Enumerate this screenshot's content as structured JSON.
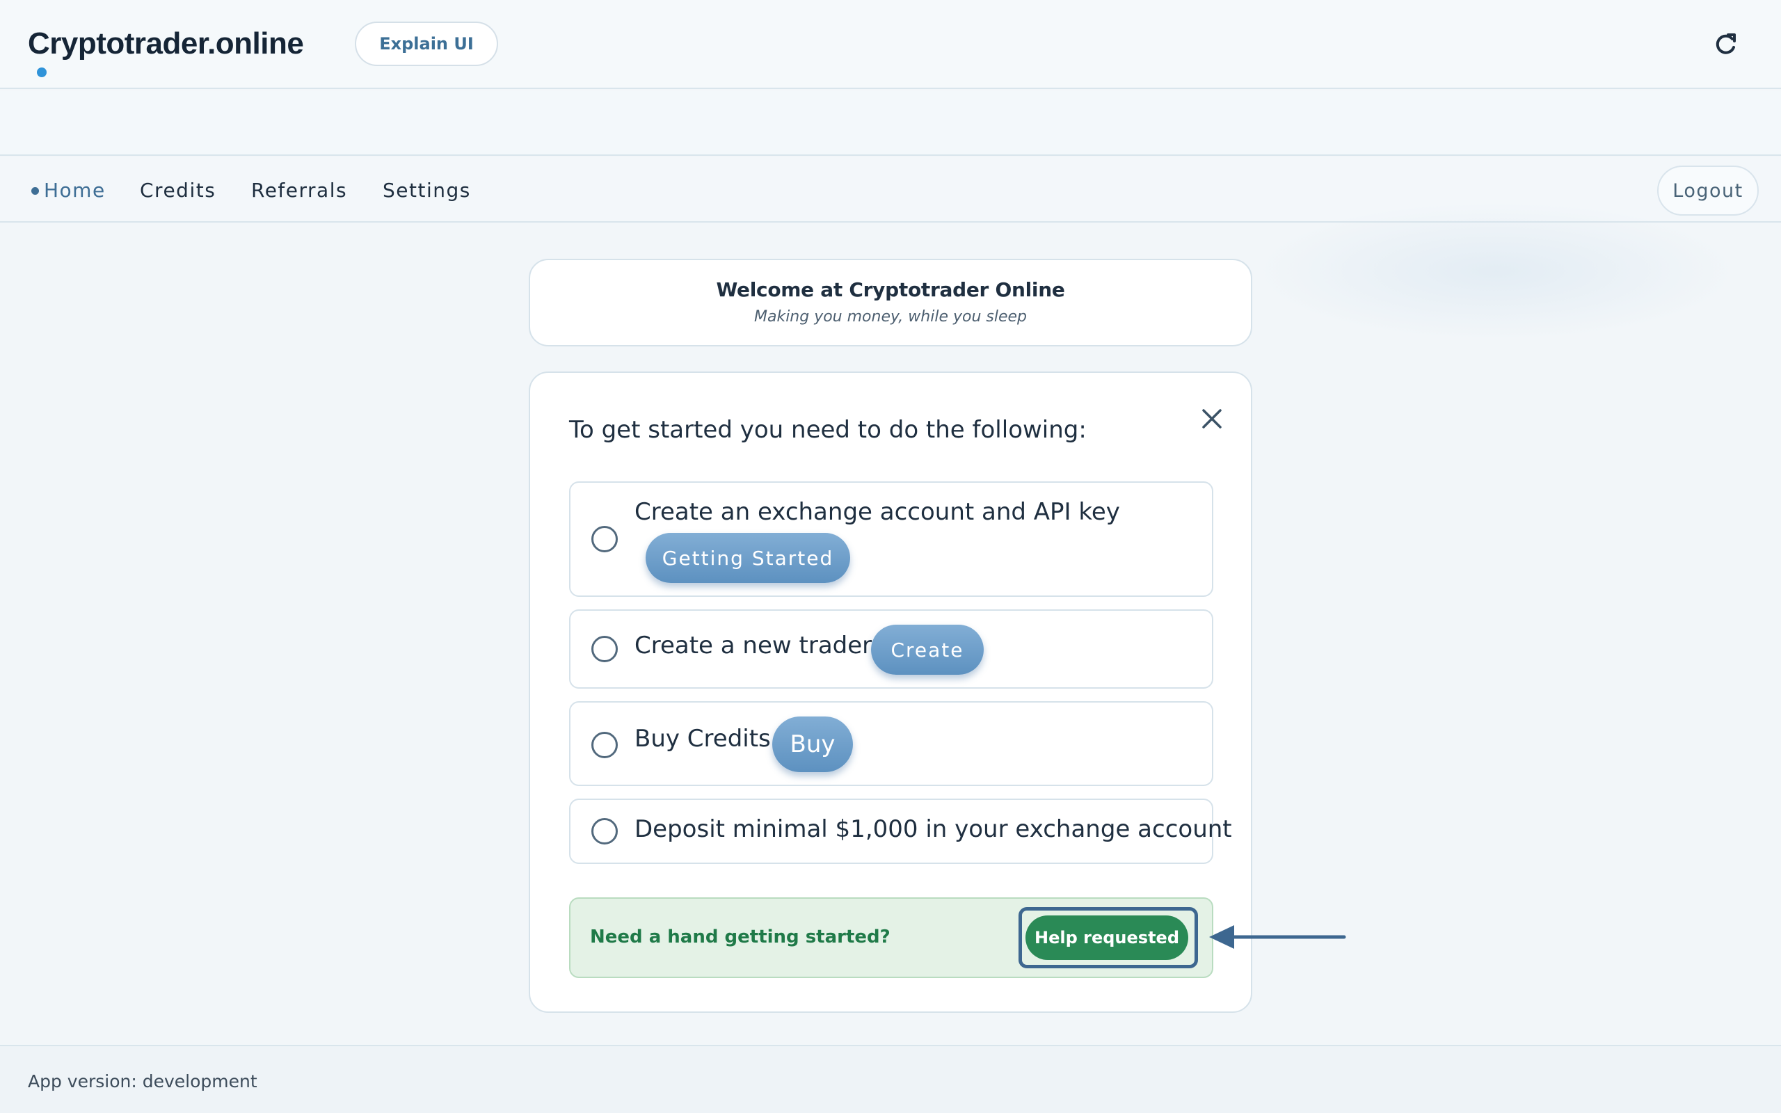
{
  "brand": {
    "title": "Cryptotrader.online"
  },
  "header": {
    "explain_label": "Explain UI",
    "refresh_icon": "refresh-icon"
  },
  "nav": {
    "items": [
      {
        "label": "Home",
        "active": true
      },
      {
        "label": "Credits",
        "active": false
      },
      {
        "label": "Referrals",
        "active": false
      },
      {
        "label": "Settings",
        "active": false
      }
    ],
    "logout_label": "Logout"
  },
  "welcome": {
    "title": "Welcome at Cryptotrader Online",
    "subtitle": "Making you money, while you sleep"
  },
  "steps": {
    "title": "To get started you need to do the following:",
    "close_icon": "close-icon",
    "items": [
      {
        "text": "Create an exchange account and API key",
        "button": "Getting Started",
        "checked": false
      },
      {
        "text": "Create a new trader",
        "button": "Create",
        "checked": false
      },
      {
        "text": "Buy Credits",
        "button": "Buy",
        "checked": false
      },
      {
        "text": "Deposit minimal $1,000 in your exchange account",
        "checked": false
      }
    ]
  },
  "help": {
    "text": "Need a hand getting started?",
    "button_label": "Help requested"
  },
  "footer": {
    "version_text": "App version: development"
  },
  "colors": {
    "accent": "#3e6e95",
    "pill_blue": "#6a9cc8",
    "success": "#2a8a56",
    "help_bg": "#e4f2e6"
  }
}
